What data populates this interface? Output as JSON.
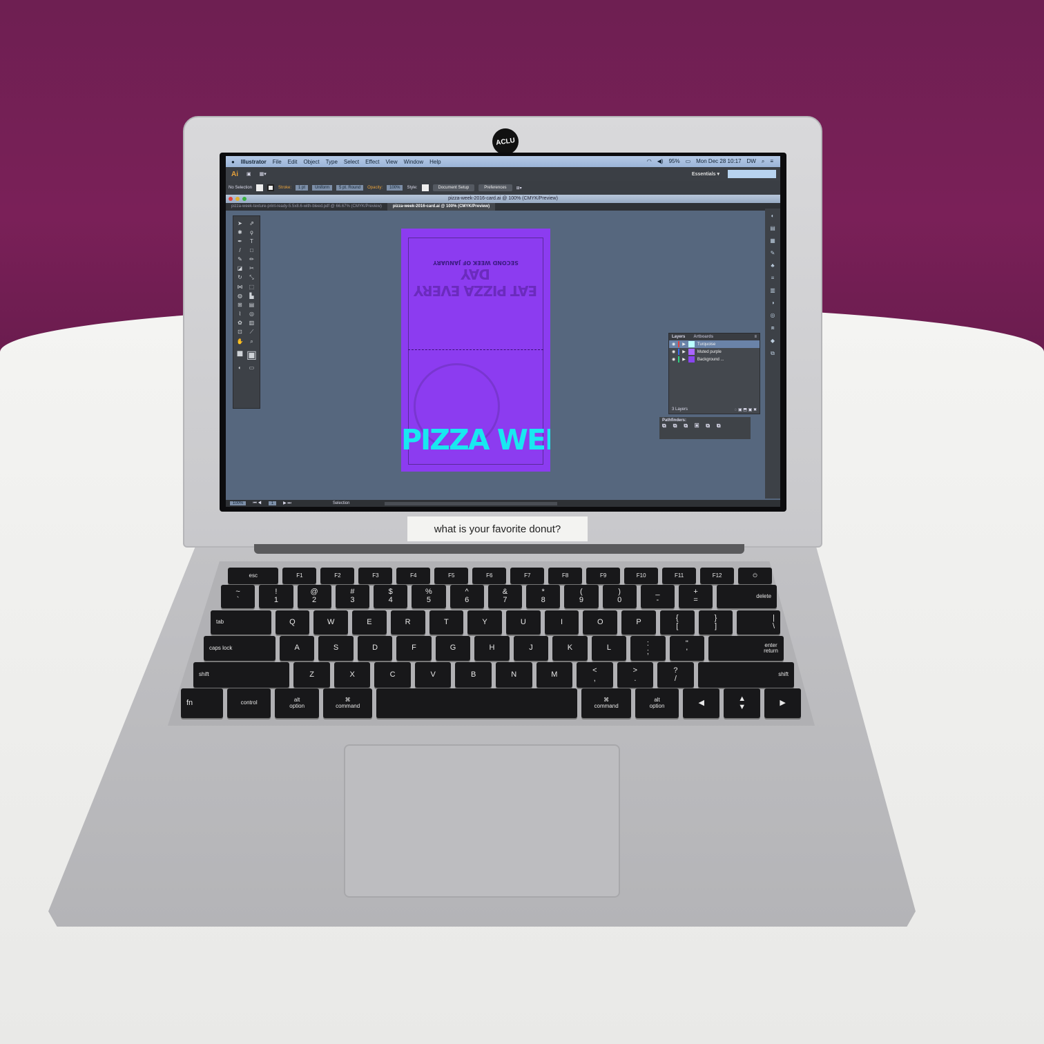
{
  "sticker": {
    "aclu": "ACLU",
    "note": "what is your favorite donut?"
  },
  "menubar": {
    "items": [
      "Illustrator",
      "File",
      "Edit",
      "Object",
      "Type",
      "Select",
      "Effect",
      "View",
      "Window",
      "Help"
    ],
    "battery": "95%",
    "datetime": "Mon Dec 28 10:17",
    "user": "DW"
  },
  "appbar": {
    "logo": "Ai",
    "workspace": "Essentials ▾"
  },
  "control": {
    "selection": "No Selection",
    "stroke_label": "Stroke:",
    "stroke_value": "1 pt",
    "profile": "Uniform",
    "brush": "5 pt. Round",
    "opacity_label": "Opacity:",
    "opacity_value": "100%",
    "style_label": "Style:",
    "document_setup": "Document Setup",
    "preferences": "Preferences"
  },
  "window": {
    "title": "pizza-week-2016-card.ai @ 100% (CMYK/Preview)",
    "tabs": [
      "pizza-week-texture-print-ready-5.5x8.6-with-bleed.pdf @ 66.67% (CMYK/Preview)",
      "pizza-week-2016-card.ai @ 100% (CMYK/Preview)"
    ]
  },
  "artboard": {
    "subtitle": "SECOND WEEK OF JANUARY",
    "headline": "EAT PIZZA EVERY DAY",
    "title": "PIZZA WEEK",
    "colors": {
      "bg": "#8c3cf0",
      "title": "#19e8f0"
    }
  },
  "layers": {
    "tabs": [
      "Layers",
      "Artboards"
    ],
    "items": [
      {
        "name": "Turquoise",
        "color": "#e04040"
      },
      {
        "name": "Muted purple",
        "color": "#3a6af0"
      },
      {
        "name": "Background ...",
        "color": "#30d080"
      }
    ],
    "count": "3 Layers",
    "pathfinders": "Pathfinders:"
  },
  "status": {
    "zoom": "100%",
    "artboard": "1",
    "tool": "Selection"
  },
  "keyboard": {
    "rows": [
      [
        "esc",
        "F1",
        "F2",
        "F3",
        "F4",
        "F5",
        "F6",
        "F7",
        "F8",
        "F9",
        "F10",
        "F11",
        "F12",
        "⏻"
      ],
      [
        "~\n`",
        "!\n1",
        "@\n2",
        "#\n3",
        "$\n4",
        "%\n5",
        "^\n6",
        "&\n7",
        "*\n8",
        "(\n9",
        ")\n0",
        "_\n-",
        "+\n=",
        "delete"
      ],
      [
        "tab",
        "Q",
        "W",
        "E",
        "R",
        "T",
        "Y",
        "U",
        "I",
        "O",
        "P",
        "{\n[",
        "}\n]",
        "|\n\\"
      ],
      [
        "caps lock",
        "A",
        "S",
        "D",
        "F",
        "G",
        "H",
        "J",
        "K",
        "L",
        ":\n;",
        "\"\n'",
        "enter\nreturn"
      ],
      [
        "shift",
        "Z",
        "X",
        "C",
        "V",
        "B",
        "N",
        "M",
        "<\n,",
        ">\n.",
        "?\n/",
        "shift"
      ],
      [
        "fn",
        "control",
        "alt\noption",
        "⌘\ncommand",
        "",
        "⌘\ncommand",
        "alt\noption",
        "◀",
        "▲\n▼",
        "▶"
      ]
    ]
  }
}
